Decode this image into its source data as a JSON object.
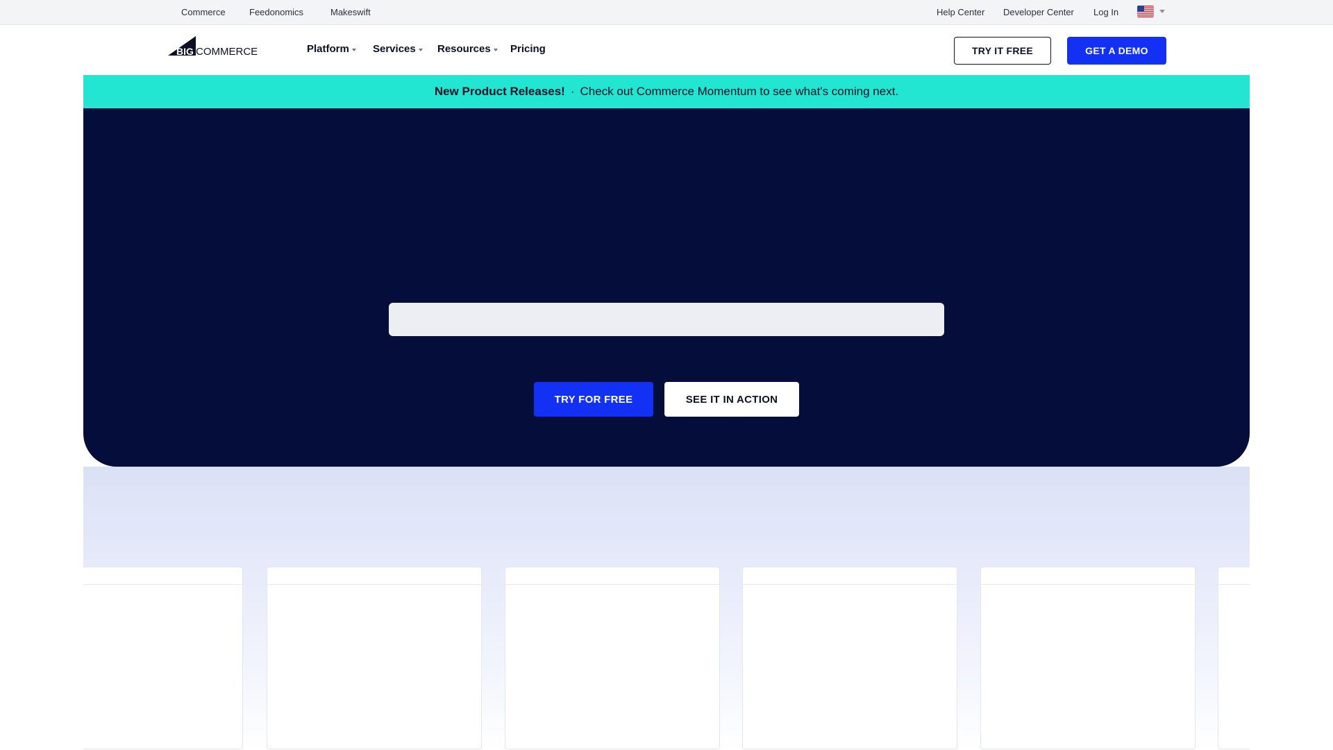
{
  "utility_bar": {
    "brands": [
      "Commerce",
      "Feedonomics",
      "Makeswift"
    ],
    "links": [
      "Help Center",
      "Developer Center",
      "Log In"
    ],
    "locale_icon": "us-flag-icon"
  },
  "nav": {
    "logo_text_big": "BIG",
    "logo_text_commerce": "COMMERCE",
    "items": [
      "Platform",
      "Services",
      "Resources",
      "Pricing"
    ],
    "try_free": "TRY IT FREE",
    "get_demo": "GET A DEMO"
  },
  "announcement": {
    "strong": "New Product Releases!",
    "separator": "·",
    "text": "Check out Commerce Momentum to see what's coming next."
  },
  "hero": {
    "try_free": "TRY FOR FREE",
    "see_action": "SEE IT IN ACTION"
  },
  "colors": {
    "accent": "#1331f5",
    "banner": "#22e6d1",
    "hero_bg": "#050d3a"
  }
}
